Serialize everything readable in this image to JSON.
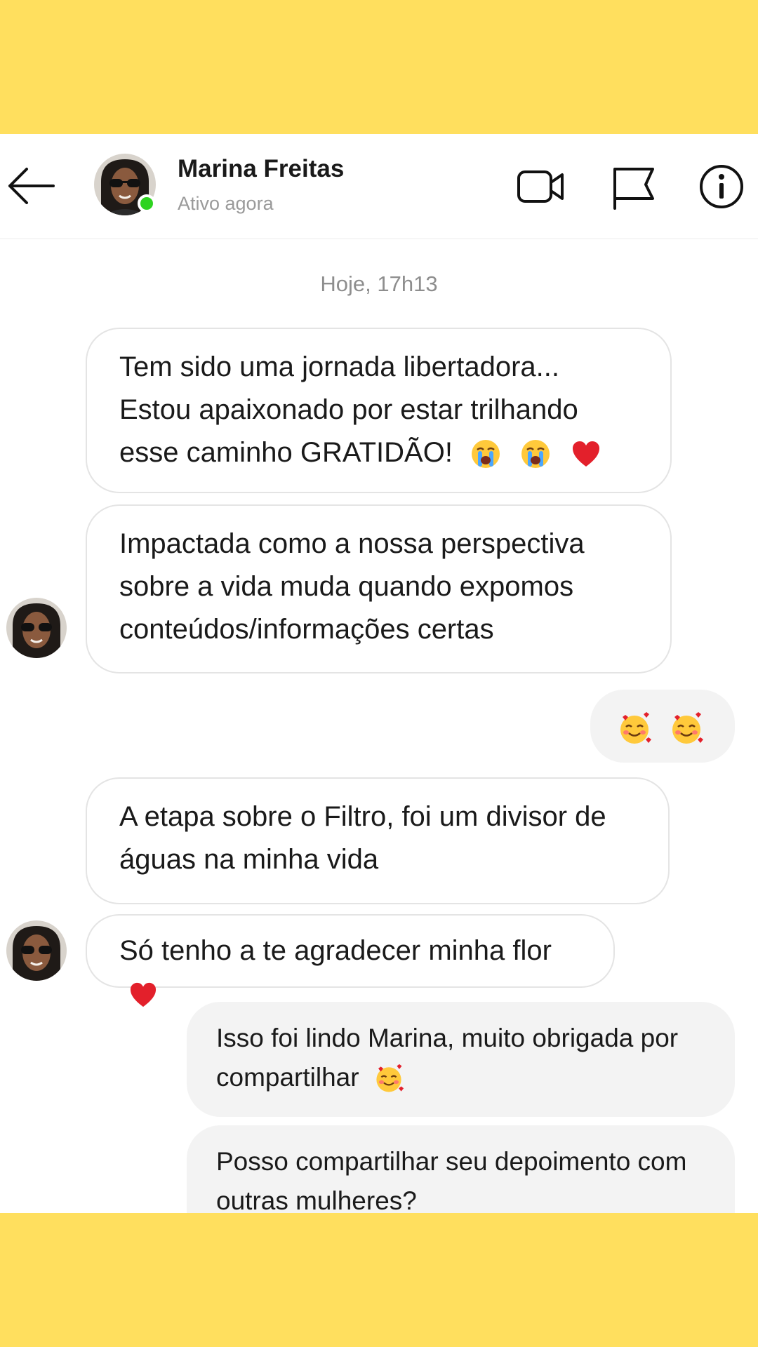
{
  "header": {
    "contact_name": "Marina Freitas",
    "status": "Ativo agora",
    "online_color": "#2ed31f",
    "icons": [
      "back-arrow-icon",
      "video-call-icon",
      "flag-icon",
      "info-icon"
    ]
  },
  "timestamp": "Hoje, 17h13",
  "messages": [
    {
      "from": "contact",
      "lines": [
        "Tem sido uma jornada libertadora...",
        "Estou apaixonado por estar trilhando",
        "esse caminho GRATIDÃO!"
      ],
      "emojis": [
        "crying-face-emoji",
        "crying-face-emoji",
        "red-heart-emoji"
      ]
    },
    {
      "from": "contact",
      "lines": [
        "Impactada como a nossa perspectiva",
        "sobre a vida muda quando expomos",
        "conteúdos/informações certas"
      ]
    },
    {
      "from": "me",
      "emojis": [
        "smiling-face-with-hearts-emoji",
        "smiling-face-with-hearts-emoji"
      ]
    },
    {
      "from": "contact",
      "lines": [
        "A etapa sobre o Filtro, foi um divisor de",
        "águas na minha vida"
      ]
    },
    {
      "from": "contact",
      "lines": [
        "Só tenho a te agradecer minha flor"
      ],
      "emojis": [
        "red-heart-emoji"
      ]
    },
    {
      "from": "me",
      "lines": [
        "Isso foi lindo Marina, muito obrigada por",
        "compartilhar"
      ],
      "emojis": [
        "smiling-face-with-hearts-emoji"
      ]
    },
    {
      "from": "me",
      "lines": [
        "Posso compartilhar seu depoimento com",
        "outras mulheres?"
      ]
    }
  ],
  "colors": {
    "band": "#FFDF5E",
    "received_border": "#e4e4e4",
    "sent_bg": "#f3f3f3"
  }
}
